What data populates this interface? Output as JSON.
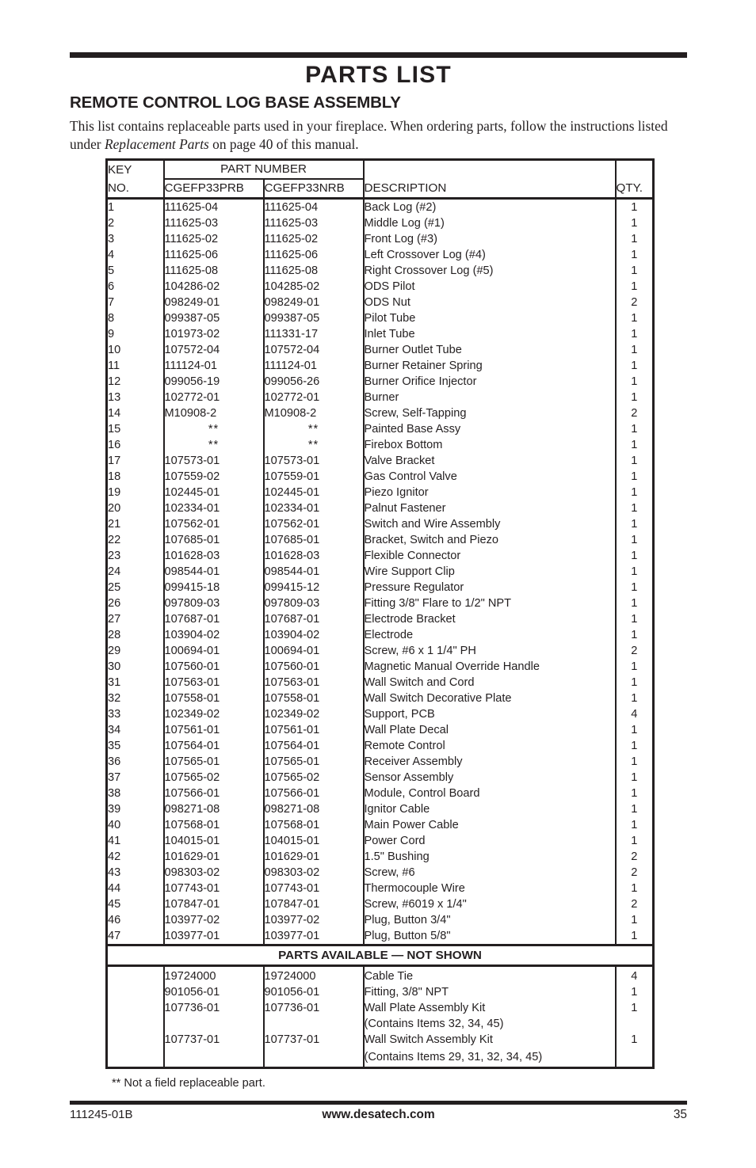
{
  "document": {
    "title": "PARTS LIST",
    "section_title": "REMOTE CONTROL LOG BASE ASSEMBLY",
    "intro_before_italic": "This list contains replaceable parts used in your fireplace. When ordering parts, follow the instructions listed under ",
    "intro_italic": "Replacement Parts",
    "intro_after_italic": " on page 40 of this manual.",
    "footnote": "** Not a field replaceable part."
  },
  "table": {
    "headers": {
      "key_line1": "KEY",
      "key_line2": "NO.",
      "part_number_group": "PART NUMBER",
      "model_1": "CGEFP33PRB",
      "model_2": "CGEFP33NRB",
      "description": "DESCRIPTION",
      "qty": "QTY."
    },
    "rows": [
      {
        "key": "1",
        "pn1": "111625-04",
        "pn2": "111625-04",
        "desc": "Back Log (#2)",
        "qty": "1"
      },
      {
        "key": "2",
        "pn1": "111625-03",
        "pn2": "111625-03",
        "desc": "Middle Log (#1)",
        "qty": "1"
      },
      {
        "key": "3",
        "pn1": "111625-02",
        "pn2": "111625-02",
        "desc": "Front Log (#3)",
        "qty": "1"
      },
      {
        "key": "4",
        "pn1": "111625-06",
        "pn2": "111625-06",
        "desc": "Left Crossover Log (#4)",
        "qty": "1"
      },
      {
        "key": "5",
        "pn1": "111625-08",
        "pn2": "111625-08",
        "desc": "Right Crossover Log (#5)",
        "qty": "1"
      },
      {
        "key": "6",
        "pn1": "104286-02",
        "pn2": "104285-02",
        "desc": "ODS Pilot",
        "qty": "1"
      },
      {
        "key": "7",
        "pn1": "098249-01",
        "pn2": "098249-01",
        "desc": "ODS Nut",
        "qty": "2"
      },
      {
        "key": "8",
        "pn1": "099387-05",
        "pn2": "099387-05",
        "desc": "Pilot Tube",
        "qty": "1"
      },
      {
        "key": "9",
        "pn1": "101973-02",
        "pn2": "111331-17",
        "desc": "Inlet Tube",
        "qty": "1"
      },
      {
        "key": "10",
        "pn1": "107572-04",
        "pn2": "107572-04",
        "desc": "Burner Outlet Tube",
        "qty": "1"
      },
      {
        "key": "11",
        "pn1": "111124-01",
        "pn2": "111124-01",
        "desc": "Burner Retainer Spring",
        "qty": "1"
      },
      {
        "key": "12",
        "pn1": "099056-19",
        "pn2": "099056-26",
        "desc": "Burner Orifice Injector",
        "qty": "1"
      },
      {
        "key": "13",
        "pn1": "102772-01",
        "pn2": "102772-01",
        "desc": "Burner",
        "qty": "1"
      },
      {
        "key": "14",
        "pn1": "M10908-2",
        "pn2": "M10908-2",
        "desc": "Screw, Self-Tapping",
        "qty": "2"
      },
      {
        "key": "15",
        "pn1": "**",
        "pn2": "**",
        "desc": "Painted Base Assy",
        "qty": "1",
        "stars": true
      },
      {
        "key": "16",
        "pn1": "**",
        "pn2": "**",
        "desc": "Firebox Bottom",
        "qty": "1",
        "stars": true
      },
      {
        "key": "17",
        "pn1": "107573-01",
        "pn2": "107573-01",
        "desc": "Valve Bracket",
        "qty": "1"
      },
      {
        "key": "18",
        "pn1": "107559-02",
        "pn2": "107559-01",
        "desc": "Gas Control Valve",
        "qty": "1"
      },
      {
        "key": "19",
        "pn1": "102445-01",
        "pn2": "102445-01",
        "desc": "Piezo Ignitor",
        "qty": "1"
      },
      {
        "key": "20",
        "pn1": "102334-01",
        "pn2": "102334-01",
        "desc": "Palnut Fastener",
        "qty": "1"
      },
      {
        "key": "21",
        "pn1": "107562-01",
        "pn2": "107562-01",
        "desc": "Switch and Wire Assembly",
        "qty": "1"
      },
      {
        "key": "22",
        "pn1": "107685-01",
        "pn2": "107685-01",
        "desc": "Bracket, Switch and Piezo",
        "qty": "1"
      },
      {
        "key": "23",
        "pn1": "101628-03",
        "pn2": "101628-03",
        "desc": "Flexible Connector",
        "qty": "1"
      },
      {
        "key": "24",
        "pn1": "098544-01",
        "pn2": "098544-01",
        "desc": "Wire Support Clip",
        "qty": "1"
      },
      {
        "key": "25",
        "pn1": "099415-18",
        "pn2": "099415-12",
        "desc": "Pressure Regulator",
        "qty": "1"
      },
      {
        "key": "26",
        "pn1": "097809-03",
        "pn2": "097809-03",
        "desc": "Fitting 3/8\" Flare to 1/2\" NPT",
        "qty": "1"
      },
      {
        "key": "27",
        "pn1": "107687-01",
        "pn2": "107687-01",
        "desc": "Electrode Bracket",
        "qty": "1"
      },
      {
        "key": "28",
        "pn1": "103904-02",
        "pn2": "103904-02",
        "desc": "Electrode",
        "qty": "1"
      },
      {
        "key": "29",
        "pn1": "100694-01",
        "pn2": "100694-01",
        "desc": "Screw, #6 x 1 1/4\" PH",
        "qty": "2"
      },
      {
        "key": "30",
        "pn1": "107560-01",
        "pn2": "107560-01",
        "desc": "Magnetic Manual Override Handle",
        "qty": "1"
      },
      {
        "key": "31",
        "pn1": "107563-01",
        "pn2": "107563-01",
        "desc": "Wall Switch and Cord",
        "qty": "1"
      },
      {
        "key": "32",
        "pn1": "107558-01",
        "pn2": "107558-01",
        "desc": "Wall Switch Decorative Plate",
        "qty": "1"
      },
      {
        "key": "33",
        "pn1": "102349-02",
        "pn2": "102349-02",
        "desc": "Support, PCB",
        "qty": "4"
      },
      {
        "key": "34",
        "pn1": "107561-01",
        "pn2": "107561-01",
        "desc": "Wall Plate Decal",
        "qty": "1"
      },
      {
        "key": "35",
        "pn1": "107564-01",
        "pn2": "107564-01",
        "desc": "Remote Control",
        "qty": "1"
      },
      {
        "key": "36",
        "pn1": "107565-01",
        "pn2": "107565-01",
        "desc": "Receiver Assembly",
        "qty": "1"
      },
      {
        "key": "37",
        "pn1": "107565-02",
        "pn2": "107565-02",
        "desc": "Sensor Assembly",
        "qty": "1"
      },
      {
        "key": "38",
        "pn1": "107566-01",
        "pn2": "107566-01",
        "desc": "Module, Control Board",
        "qty": "1"
      },
      {
        "key": "39",
        "pn1": "098271-08",
        "pn2": "098271-08",
        "desc": "Ignitor Cable",
        "qty": "1"
      },
      {
        "key": "40",
        "pn1": "107568-01",
        "pn2": "107568-01",
        "desc": "Main Power Cable",
        "qty": "1"
      },
      {
        "key": "41",
        "pn1": "104015-01",
        "pn2": "104015-01",
        "desc": "Power Cord",
        "qty": "1"
      },
      {
        "key": "42",
        "pn1": "101629-01",
        "pn2": "101629-01",
        "desc": "1.5\" Bushing",
        "qty": "2"
      },
      {
        "key": "43",
        "pn1": "098303-02",
        "pn2": "098303-02",
        "desc": "Screw, #6",
        "qty": "2"
      },
      {
        "key": "44",
        "pn1": "107743-01",
        "pn2": "107743-01",
        "desc": "Thermocouple Wire",
        "qty": "1"
      },
      {
        "key": "45",
        "pn1": "107847-01",
        "pn2": "107847-01",
        "desc": "Screw, #6019 x 1/4\"",
        "qty": "2"
      },
      {
        "key": "46",
        "pn1": "103977-02",
        "pn2": "103977-02",
        "desc": "Plug, Button 3/4\"",
        "qty": "1"
      },
      {
        "key": "47",
        "pn1": "103977-01",
        "pn2": "103977-01",
        "desc": "Plug, Button 5/8\"",
        "qty": "1"
      }
    ],
    "not_shown_banner": "PARTS AVAILABLE — NOT SHOWN",
    "not_shown_rows": [
      {
        "key": "",
        "pn1": "19724000",
        "pn2": "19724000",
        "desc": "Cable Tie",
        "qty": "4"
      },
      {
        "key": "",
        "pn1": "901056-01",
        "pn2": "901056-01",
        "desc": "Fitting, 3/8\" NPT",
        "qty": "1"
      },
      {
        "key": "",
        "pn1": "107736-01",
        "pn2": "107736-01",
        "desc": "Wall Plate Assembly Kit",
        "qty": "1"
      },
      {
        "key": "",
        "pn1": "",
        "pn2": "",
        "desc": "(Contains Items 32, 34, 45)",
        "qty": ""
      },
      {
        "key": "",
        "pn1": "107737-01",
        "pn2": "107737-01",
        "desc": "Wall Switch Assembly Kit",
        "qty": "1"
      },
      {
        "key": "",
        "pn1": "",
        "pn2": "",
        "desc": "(Contains Items 29, 31, 32, 34, 45)",
        "qty": ""
      }
    ]
  },
  "footer": {
    "document_number": "111245-01B",
    "website": "www.desatech.com",
    "page_number": "35"
  }
}
